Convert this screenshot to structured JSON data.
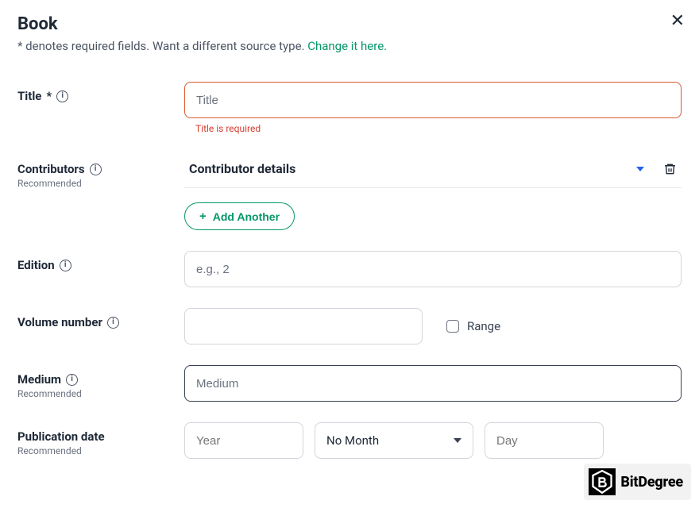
{
  "header": {
    "title": "Book",
    "subtitle_prefix": "* denotes required fields. Want a different source type. ",
    "subtitle_link": "Change it here."
  },
  "fields": {
    "title": {
      "label": "Title",
      "required_marker": "*",
      "placeholder": "Title",
      "error": "Title is required"
    },
    "contributors": {
      "label": "Contributors",
      "hint": "Recommended",
      "accordion_label": "Contributor details",
      "add_label": "Add Another"
    },
    "edition": {
      "label": "Edition",
      "placeholder": "e.g., 2"
    },
    "volume": {
      "label": "Volume number",
      "range_label": "Range"
    },
    "medium": {
      "label": "Medium",
      "hint": "Recommended",
      "placeholder": "Medium"
    },
    "pubdate": {
      "label": "Publication date",
      "hint": "Recommended",
      "year_placeholder": "Year",
      "month_value": "No Month",
      "day_placeholder": "Day"
    }
  },
  "watermark": {
    "text": "BitDegree"
  }
}
